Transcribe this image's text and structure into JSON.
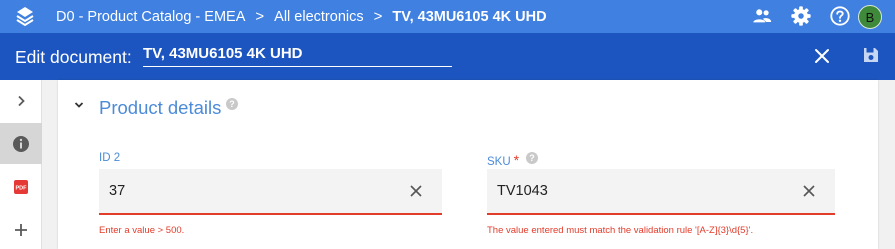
{
  "breadcrumb": {
    "items": [
      "D0 - Product Catalog - EMEA",
      "All electronics",
      "TV, 43MU6105 4K UHD"
    ],
    "separator": ">"
  },
  "topbar": {
    "icons": [
      "people-icon",
      "gear-icon",
      "help-icon"
    ],
    "avatar_initial": "B"
  },
  "editbar": {
    "label": "Edit document:",
    "title": "TV, 43MU6105 4K UHD",
    "icons": [
      "close-icon",
      "save-icon"
    ]
  },
  "leftrail": {
    "items": [
      "chevron-right-icon",
      "info-icon",
      "pdf-icon",
      "plus-icon"
    ],
    "pdf_label": "PDF"
  },
  "section": {
    "title": "Product details",
    "help": "?"
  },
  "fields": [
    {
      "label": "ID 2",
      "value": "37",
      "required": false,
      "error": "Enter a value > 500."
    },
    {
      "label": "SKU",
      "value": "TV1043",
      "required": true,
      "required_mark": "*",
      "help": "?",
      "error": "The value entered must match the validation rule '[A-Z]{3}\\d{5}'."
    }
  ],
  "colors": {
    "topbar": "#3f80e0",
    "editbar": "#1d55c0",
    "accent": "#4c8bd8",
    "error": "#e23c2b",
    "avatar": "#3f8a3a"
  }
}
